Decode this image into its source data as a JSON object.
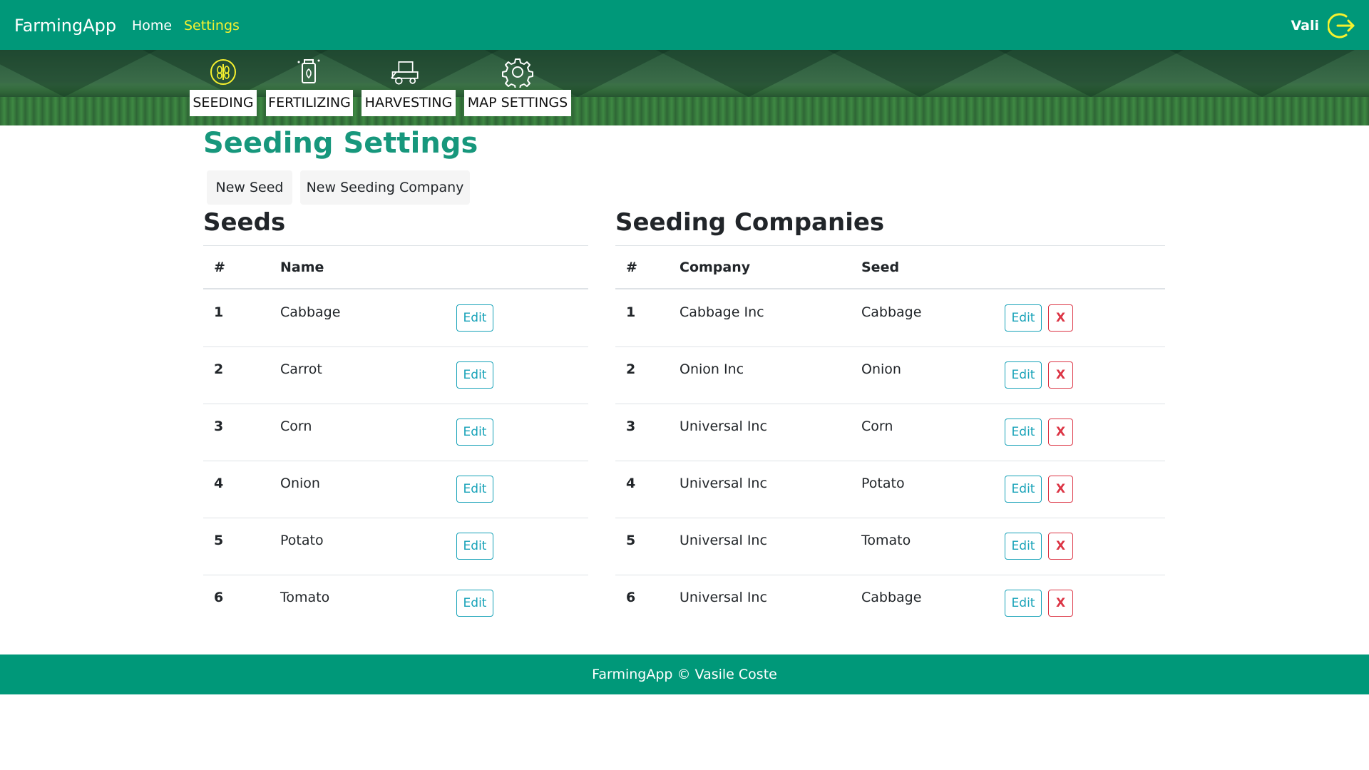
{
  "navbar": {
    "brand": "FarmingApp",
    "links": [
      "Home",
      "Settings"
    ],
    "active": "Settings",
    "user": "Vali",
    "logout_icon": "logout-icon",
    "accent": "#f6f12f",
    "bg": "#009879"
  },
  "categories": [
    {
      "label": "SEEDING",
      "icon": "seeding-icon"
    },
    {
      "label": "FERTILIZING",
      "icon": "fertilizing-icon"
    },
    {
      "label": "HARVESTING",
      "icon": "harvesting-icon"
    },
    {
      "label": "MAP SETTINGS",
      "icon": "gear-icon"
    }
  ],
  "page_title": "Seeding Settings",
  "actions": {
    "new_seed": "New Seed",
    "new_company": "New Seeding Company"
  },
  "seeds": {
    "title": "Seeds",
    "headers": [
      "#",
      "Name"
    ],
    "rows": [
      {
        "id": "1",
        "name": "Cabbage"
      },
      {
        "id": "2",
        "name": "Carrot"
      },
      {
        "id": "3",
        "name": "Corn"
      },
      {
        "id": "4",
        "name": "Onion"
      },
      {
        "id": "5",
        "name": "Potato"
      },
      {
        "id": "6",
        "name": "Tomato"
      }
    ],
    "edit_label": "Edit"
  },
  "companies": {
    "title": "Seeding Companies",
    "headers": [
      "#",
      "Company",
      "Seed"
    ],
    "rows": [
      {
        "id": "1",
        "company": "Cabbage Inc",
        "seed": "Cabbage"
      },
      {
        "id": "2",
        "company": "Onion Inc",
        "seed": "Onion"
      },
      {
        "id": "3",
        "company": "Universal Inc",
        "seed": "Corn"
      },
      {
        "id": "4",
        "company": "Universal Inc",
        "seed": "Potato"
      },
      {
        "id": "5",
        "company": "Universal Inc",
        "seed": "Tomato"
      },
      {
        "id": "6",
        "company": "Universal Inc",
        "seed": "Cabbage"
      }
    ],
    "edit_label": "Edit",
    "delete_label": "X"
  },
  "footer": "FarmingApp © Vasile Coste"
}
